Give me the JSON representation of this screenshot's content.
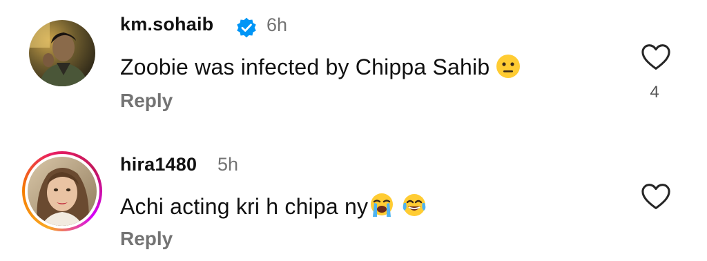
{
  "comments": [
    {
      "username": "km.sohaib",
      "verified": true,
      "time": "6h",
      "text": "Zoobie was infected by Chippa Sahib",
      "emoji": [
        "neutral-face"
      ],
      "reply_label": "Reply",
      "like_count": "4"
    },
    {
      "username": "hira1480",
      "verified": false,
      "time": "5h",
      "text": "Achi acting kri h chipa ny",
      "emoji": [
        "loudly-crying-face",
        "face-with-tears-of-joy"
      ],
      "reply_label": "Reply",
      "has_story_ring": true
    }
  ],
  "colors": {
    "verified_badge": "#0095f6",
    "secondary_text": "#737373",
    "emoji_yellow": "#ffcc33"
  }
}
